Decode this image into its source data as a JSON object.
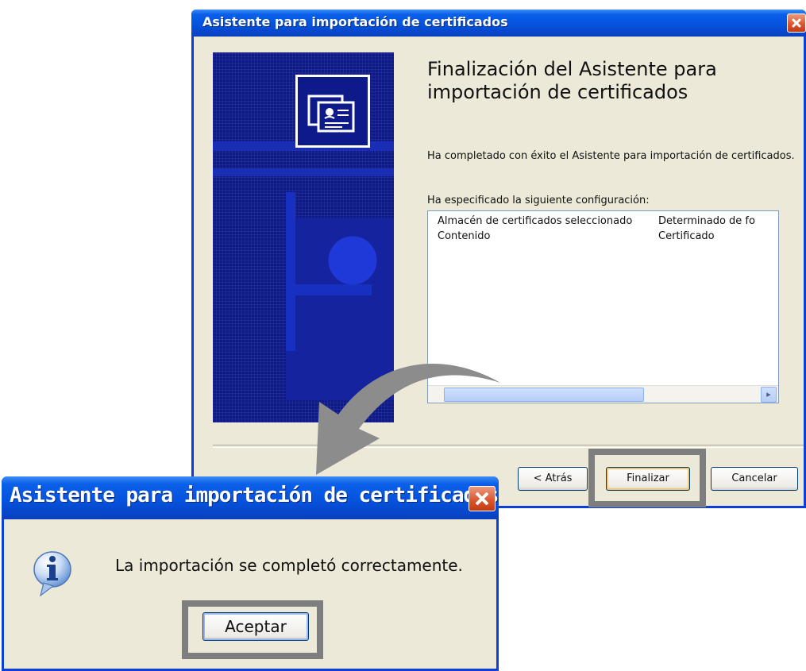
{
  "wizard": {
    "title": "Asistente para importación de certificados",
    "heading": "Finalización del Asistente para importación de certificados",
    "intro_text": "Ha completado con éxito el Asistente para importación de certificados.",
    "config_label": "Ha especificado la siguiente configuración:",
    "summary_rows": [
      {
        "setting": "Almacén de certificados seleccionado",
        "value": "Determinado de fo"
      },
      {
        "setting": "Contenido",
        "value": "Certificado"
      }
    ],
    "buttons": {
      "back": "< Atrás",
      "finish": "Finalizar",
      "cancel": "Cancelar"
    }
  },
  "message_dialog": {
    "title": "Asistente para importación de certificados",
    "message": "La importación se completó correctamente.",
    "ok_label": "Aceptar",
    "icon": "info-icon"
  },
  "colors": {
    "titlebar": "#0553df",
    "dialog_bg": "#ece9d8",
    "highlight": "#7e7e7e",
    "arrow": "#8c8c8c",
    "close": "#d9532b"
  }
}
